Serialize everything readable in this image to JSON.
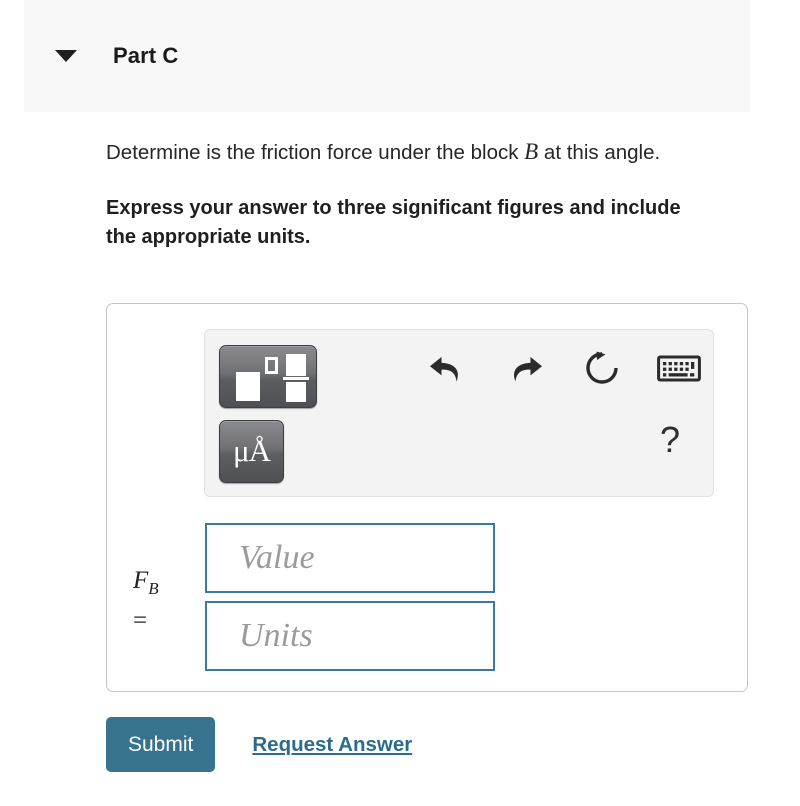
{
  "header": {
    "disclosure_icon": "triangle-down-icon",
    "title": "Part C"
  },
  "question": {
    "text_before_var": "Determine is the friction force under the block ",
    "variable": "B",
    "text_after_var": " at this angle.",
    "instruction": "Express your answer to three significant figures and include the appropriate units."
  },
  "toolbar": {
    "template_button": {
      "name": "math-template-button",
      "label": ""
    },
    "units_button": {
      "name": "units-button",
      "label": "μÅ"
    },
    "icons": [
      {
        "name": "undo-icon",
        "label": "Undo"
      },
      {
        "name": "redo-icon",
        "label": "Redo"
      },
      {
        "name": "reset-icon",
        "label": "Reset"
      },
      {
        "name": "keyboard-icon",
        "label": "Keyboard shortcuts"
      }
    ],
    "help_label": "?"
  },
  "answer": {
    "variable_symbol": "F",
    "variable_subscript": "B",
    "equals": "=",
    "value_placeholder": "Value",
    "value_current": "",
    "units_placeholder": "Units",
    "units_current": ""
  },
  "footer": {
    "submit_label": "Submit",
    "request_answer_label": "Request Answer"
  },
  "colors": {
    "accent": "#37738f",
    "field_border": "#3a7a9e",
    "link": "#2b6c8c",
    "header_band": "#f8f8f8",
    "toolbar_bg": "#f3f3f3"
  }
}
